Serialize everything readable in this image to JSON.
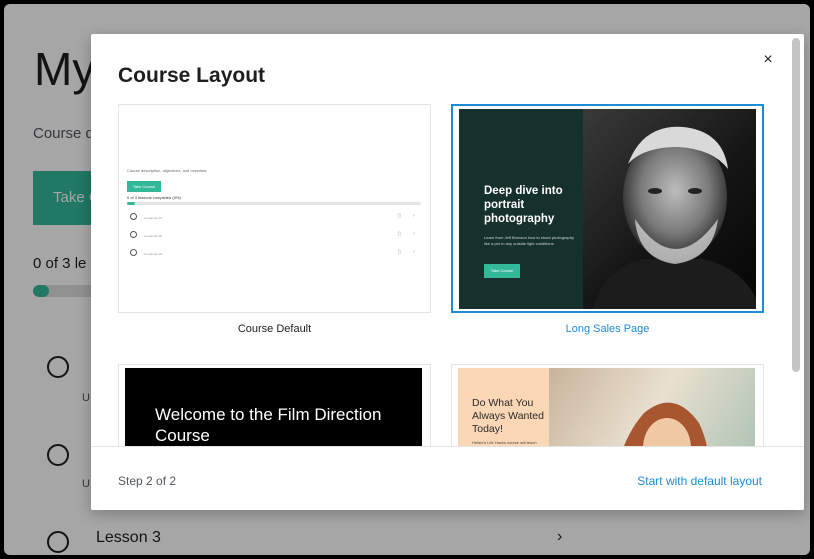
{
  "background": {
    "title": "My",
    "description": "Course d",
    "take_button": "Take C",
    "progress_text": "0 of 3 le",
    "progress_fraction": 0.2,
    "u1": "U",
    "u2": "U",
    "lesson3": "Lesson 3",
    "chevron": "›"
  },
  "modal": {
    "title": "Course Layout",
    "close": "×",
    "layouts": [
      {
        "label": "Course Default",
        "selected": false,
        "thumb": {
          "description": "Course description, objectives, and overview.",
          "button": "Take Course",
          "progress": "0 of 3 lessons completed (0%)",
          "rows": [
            "A example #1",
            "A example #2",
            "A example #3"
          ]
        }
      },
      {
        "label": "Long Sales Page",
        "selected": true,
        "thumb": {
          "headline": "Deep dive into portrait photography",
          "subtext": "Learn from Jeff Bronson how to shoot photography like a pro in any outside light conditions.",
          "button": "Take Course"
        }
      },
      {
        "label": "",
        "thumb": {
          "headline": "Welcome to the Film Direction Course"
        }
      },
      {
        "label": "",
        "thumb": {
          "headline": "Do What You Always Wanted Today!",
          "subtext": "Hellen's Life Hacks course will teach"
        }
      }
    ],
    "footer": {
      "step": "Step 2 of 2",
      "start_default": "Start with default layout"
    }
  },
  "colors": {
    "accent": "#1e8bd6",
    "brand_green": "#34b89a"
  }
}
